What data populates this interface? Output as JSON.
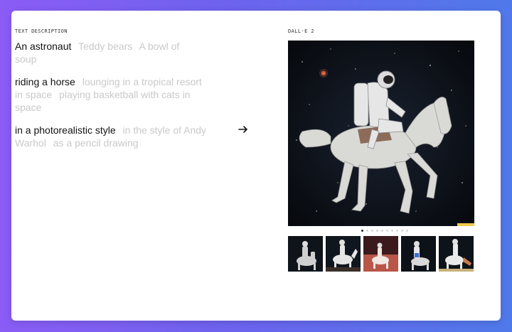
{
  "left": {
    "section_label": "TEXT DESCRIPTION",
    "groups": [
      {
        "selected": "An astronaut",
        "options": [
          "Teddy bears",
          "A bowl of soup"
        ]
      },
      {
        "selected": "riding a horse",
        "options": [
          "lounging in a tropical resort in space",
          "playing basketball with cats in space"
        ]
      },
      {
        "selected": "in a photorealistic style",
        "options": [
          "in the style of Andy Warhol",
          "as a pencil drawing"
        ]
      }
    ]
  },
  "arrow_icon": "arrow-right-icon",
  "right": {
    "section_label": "DALL·E 2",
    "dots_total": 10,
    "active_dot": 0
  }
}
